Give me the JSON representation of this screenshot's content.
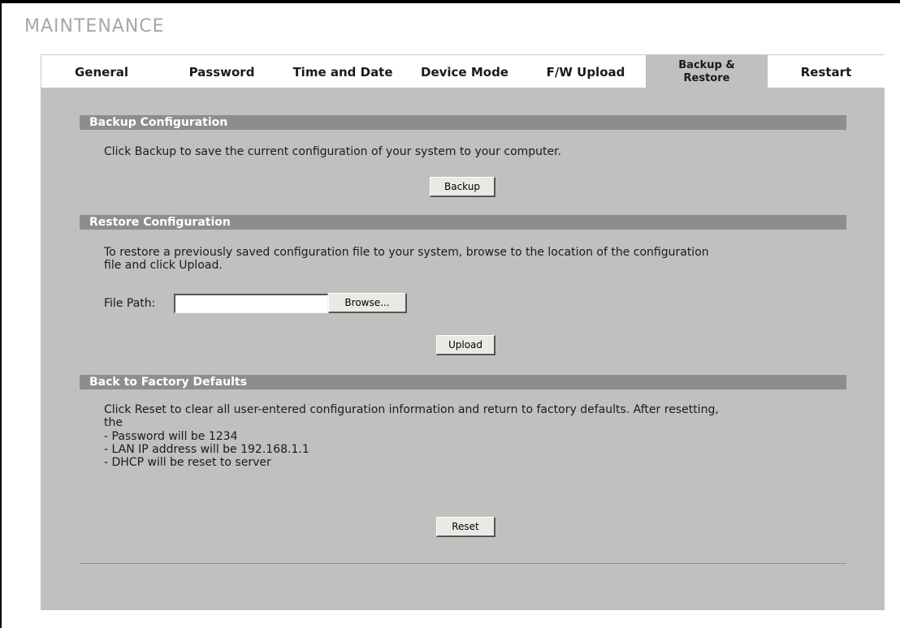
{
  "page": {
    "title": "MAINTENANCE"
  },
  "tabs": [
    {
      "label": "General"
    },
    {
      "label": "Password"
    },
    {
      "label": "Time and Date"
    },
    {
      "label": "Device Mode"
    },
    {
      "label": "F/W Upload"
    },
    {
      "label": "Backup & Restore"
    },
    {
      "label": "Restart"
    }
  ],
  "backup": {
    "header": "Backup Configuration",
    "description": "Click Backup to save the current configuration of your system to your computer.",
    "button": "Backup"
  },
  "restore": {
    "header": "Restore Configuration",
    "description_line1": "To restore a previously saved configuration file to your system, browse to the location of the configuration",
    "description_line2": "file and click Upload.",
    "file_label": "File Path:",
    "file_value": "",
    "browse_button": "Browse...",
    "upload_button": "Upload"
  },
  "factory": {
    "header": "Back to Factory Defaults",
    "line1": "Click Reset to clear all user-entered configuration information and return to factory defaults. After resetting,",
    "line2": "the",
    "line3": "- Password will be 1234",
    "line4": "- LAN IP address will be 192.168.1.1",
    "line5": "- DHCP will be reset to server",
    "button": "Reset"
  },
  "colors": {
    "panel": "#c1bfbf",
    "section_bar": "#8d8d8d",
    "title": "#a7a7a7"
  }
}
